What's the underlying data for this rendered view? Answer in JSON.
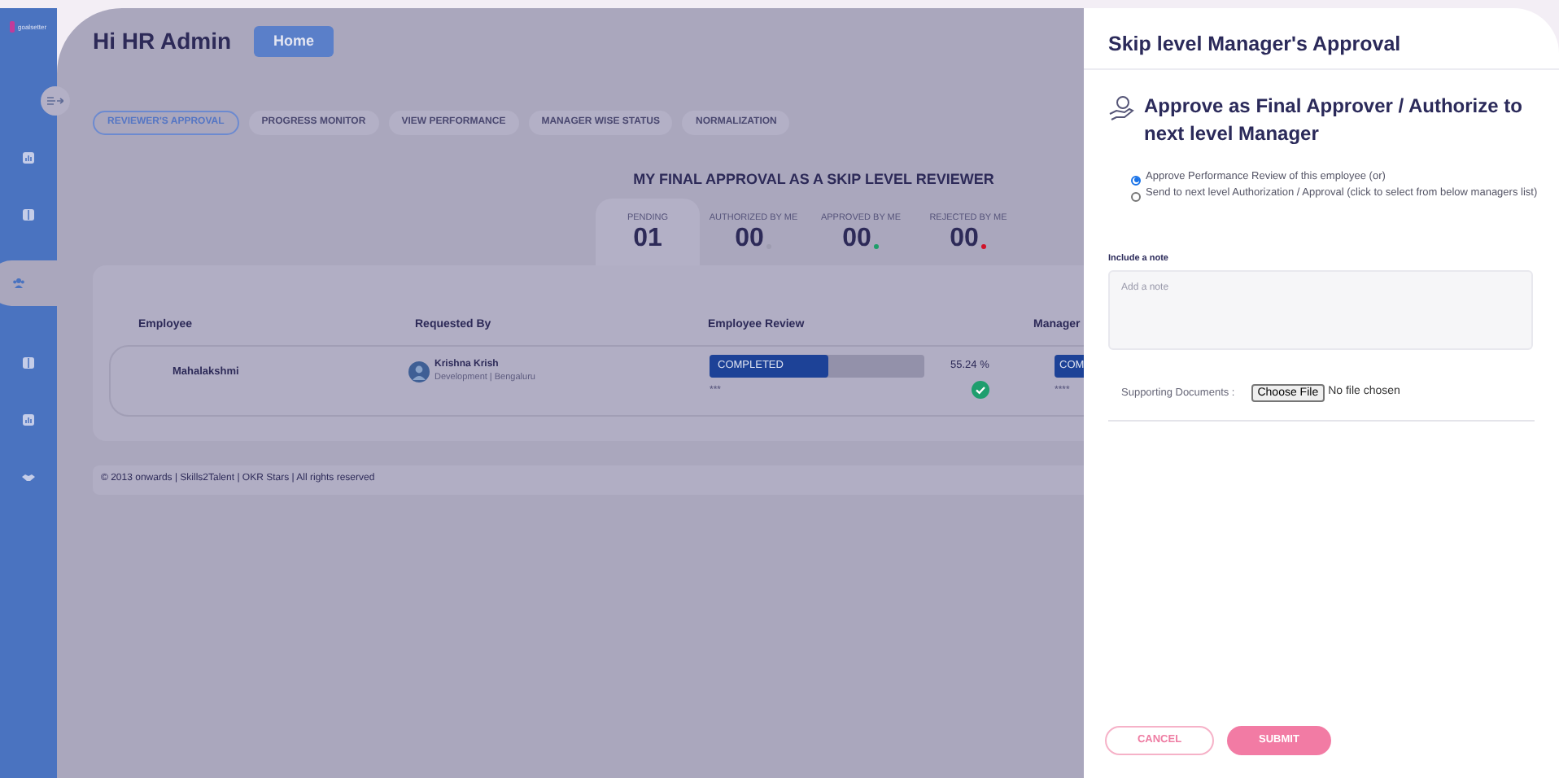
{
  "sidebar": {
    "logo": "goalsetter",
    "items": [
      {
        "kind": "chart",
        "selected": false
      },
      {
        "kind": "book",
        "selected": false
      },
      {
        "kind": "people",
        "selected": true
      },
      {
        "kind": "book",
        "selected": false
      },
      {
        "kind": "chart",
        "selected": false
      },
      {
        "kind": "handshake",
        "selected": false
      }
    ]
  },
  "header": {
    "greeting": "Hi HR Admin",
    "home_button": "Home"
  },
  "tabs": [
    {
      "label": "REVIEWER'S APPROVAL",
      "selected": true
    },
    {
      "label": "PROGRESS MONITOR",
      "selected": false
    },
    {
      "label": "VIEW PERFORMANCE",
      "selected": false
    },
    {
      "label": "MANAGER WISE STATUS",
      "selected": false
    },
    {
      "label": "NORMALIZATION",
      "selected": false
    }
  ],
  "summary": {
    "title": "MY FINAL APPROVAL AS A SKIP LEVEL REVIEWER",
    "stats": [
      {
        "label": "PENDING",
        "value": "01",
        "selected": true
      },
      {
        "label": "AUTHORIZED BY ME",
        "value": "00",
        "selected": false,
        "color": "#9e9cb0"
      },
      {
        "label": "APPROVED BY ME",
        "value": "00",
        "selected": false,
        "color": "#1e9e6a"
      },
      {
        "label": "REJECTED BY ME",
        "value": "00",
        "selected": false,
        "color": "#d0132a"
      }
    ]
  },
  "table": {
    "columns": [
      "Employee",
      "Requested By",
      "Employee Review",
      "Manager"
    ],
    "rows": [
      {
        "employee": "Mahalakshmi",
        "requester": "Krishna Krish",
        "requester_detail": "Development | Bengaluru",
        "review_status": "COMPLETED",
        "level": 0.5524,
        "review_stars": "***",
        "percent": "55.24 %",
        "approved": true,
        "manager_status": "COM",
        "manager_stars": "****"
      }
    ]
  },
  "footer": "© 2013 onwards | Skills2Talent | OKR Stars | All rights reserved",
  "drawer": {
    "title": "Skip level Manager's Approval",
    "heading": "Approve as Final Approver / Authorize to next level Manager",
    "options": [
      {
        "label": "Approve Performance Review of this employee (or)",
        "selected": true
      },
      {
        "label": "Send to next level Authorization / Approval (click to select from below managers list)",
        "selected": false
      }
    ],
    "note_label": "Include a note",
    "note_placeholder": "Add a note",
    "documents_label": "Supporting Documents :",
    "file_button": "Choose File",
    "file_status": "No file chosen",
    "cancel": "CANCEL",
    "submit": "SUBMIT"
  }
}
